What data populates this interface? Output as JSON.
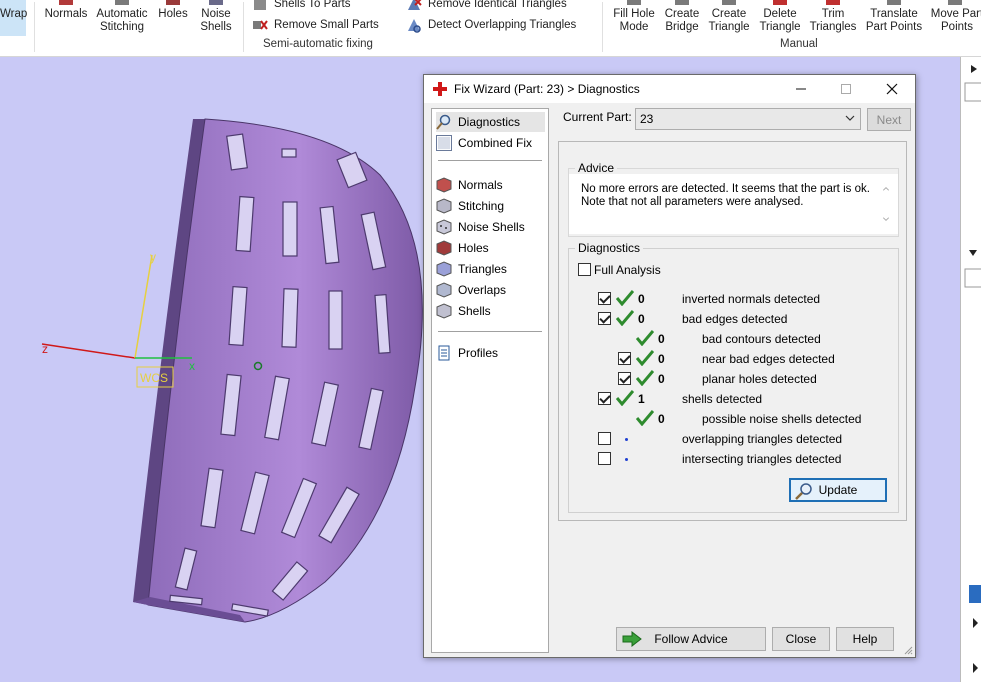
{
  "ribbon": {
    "wrap_label": "Wrap",
    "buttons": [
      {
        "label": "Normals"
      },
      {
        "label": "Automatic Stitching"
      },
      {
        "label": "Holes"
      },
      {
        "label": "Noise Shells"
      }
    ],
    "semi_auto": {
      "shells_to_parts": "Shells To Parts",
      "remove_small_parts": "Remove Small Parts",
      "remove_identical": "Remove Identical Triangles",
      "detect_overlapping": "Detect Overlapping Triangles",
      "group_label": "Semi-automatic fixing"
    },
    "manual": {
      "buttons": [
        {
          "label": "Fill Hole Mode"
        },
        {
          "label": "Create Bridge"
        },
        {
          "label": "Create Triangle"
        },
        {
          "label": "Delete Triangle"
        },
        {
          "label": "Trim Triangles"
        },
        {
          "label": "Translate Part Points"
        },
        {
          "label": "Move Part Points"
        }
      ],
      "group_label": "Manual"
    }
  },
  "viewport": {
    "axis_z": "z",
    "axis_y": "y",
    "axis_x": "x",
    "wcs_label": "WCS"
  },
  "dialog": {
    "title": "Fix Wizard (Part: 23) > Diagnostics",
    "nav": {
      "top_items": [
        {
          "label": "Diagnostics",
          "selected": true
        },
        {
          "label": "Combined Fix",
          "selected": false
        }
      ],
      "check_items": [
        {
          "label": "Normals"
        },
        {
          "label": "Stitching"
        },
        {
          "label": "Noise Shells"
        },
        {
          "label": "Holes"
        },
        {
          "label": "Triangles"
        },
        {
          "label": "Overlaps"
        },
        {
          "label": "Shells"
        }
      ],
      "bottom_items": [
        {
          "label": "Profiles"
        }
      ]
    },
    "current_part_label": "Current Part:",
    "current_part_value": "23",
    "next_label": "Next",
    "advice": {
      "title": "Advice",
      "text_line1": "No more errors are detected. It seems that the part is ok.",
      "text_line2": "Note that not all parameters were analysed."
    },
    "diagnostics": {
      "title": "Diagnostics",
      "full_analysis_label": "Full Analysis",
      "full_analysis_checked": false,
      "rows": [
        {
          "count": "0",
          "label": "inverted normals detected"
        },
        {
          "count": "0",
          "label": "bad edges detected"
        },
        {
          "count": "0",
          "label": "bad contours detected"
        },
        {
          "count": "0",
          "label": "near bad edges detected"
        },
        {
          "count": "0",
          "label": "planar holes detected"
        },
        {
          "count": "1",
          "label": "shells detected"
        },
        {
          "count": "0",
          "label": "possible noise shells detected"
        },
        {
          "count": "",
          "label": "overlapping triangles detected"
        },
        {
          "count": "",
          "label": "intersecting triangles detected"
        }
      ]
    },
    "update_label": "Update",
    "follow_advice_label": "Follow Advice",
    "close_label": "Close",
    "help_label": "Help"
  },
  "colors": {
    "viewport_bg": "#c9c9f6",
    "part_purple": "#9a78c4",
    "tick_green": "#2e8b2e",
    "selection_blue": "#1f6fb5"
  }
}
